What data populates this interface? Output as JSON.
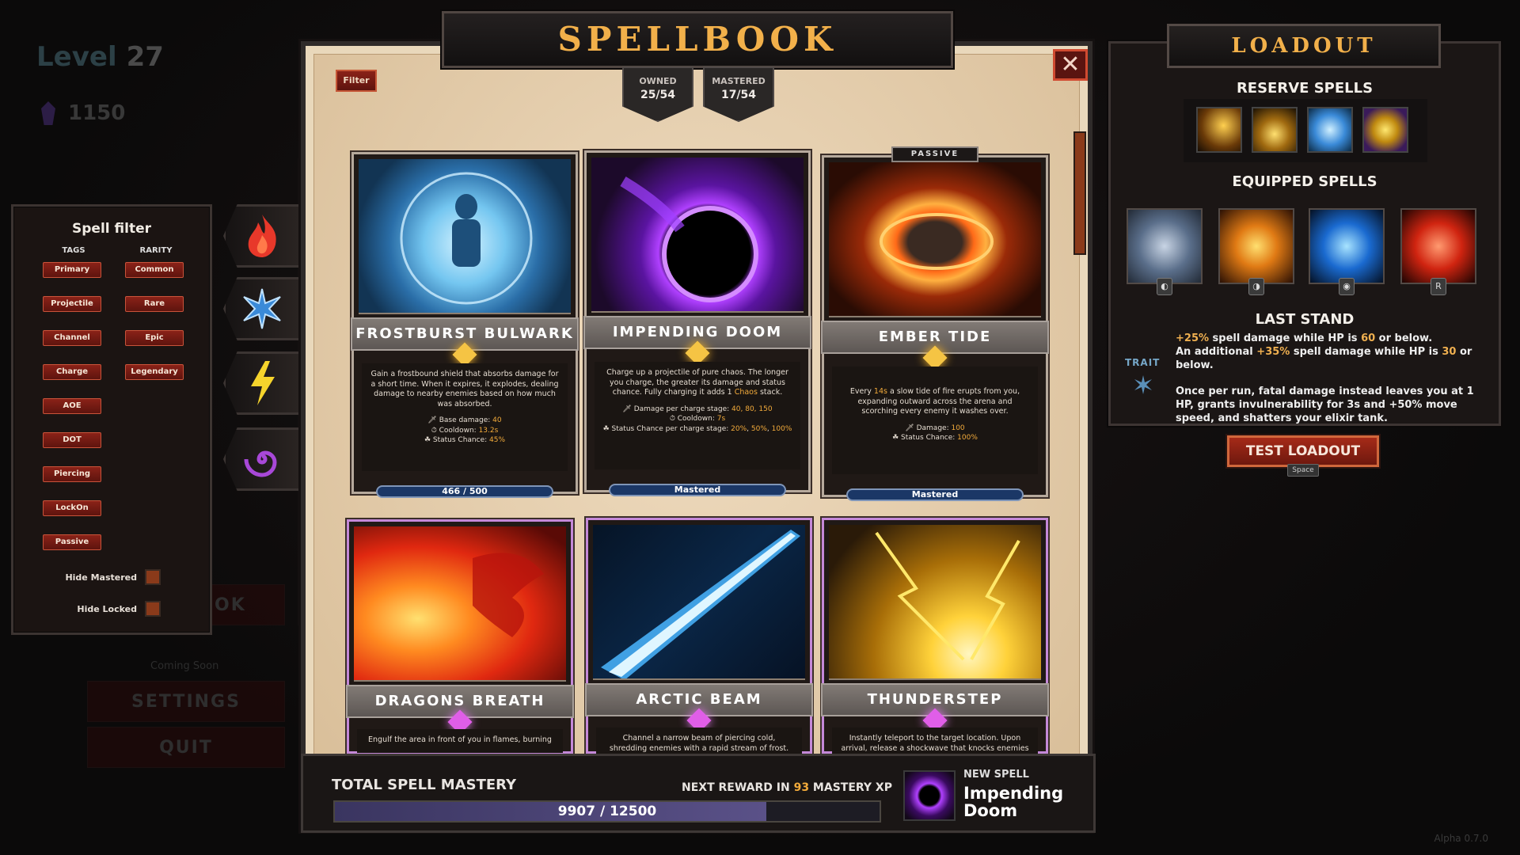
{
  "background": {
    "level_label": "Level",
    "level_value": "27",
    "gems": "1150",
    "menu_partial": "OK",
    "coming_soon": "Coming Soon",
    "settings": "SETTINGS",
    "quit": "QUIT",
    "version": "Alpha  0.7.0"
  },
  "filter": {
    "title": "Spell filter",
    "tags_header": "TAGS",
    "rarity_header": "RARITY",
    "tags": [
      "Primary",
      "Projectile",
      "Channel",
      "Charge",
      "AOE",
      "DOT",
      "Piercing",
      "LockOn",
      "Passive"
    ],
    "rarities": [
      "Common",
      "Rare",
      "Epic",
      "Legendary"
    ],
    "hide_mastered": "Hide Mastered",
    "hide_locked": "Hide Locked"
  },
  "element_tabs": [
    "fire-icon",
    "frost-icon",
    "lightning-icon",
    "chaos-icon"
  ],
  "spellbook": {
    "title": "SPELLBOOK",
    "filter_button": "Filter",
    "owned_label": "OWNED",
    "owned_value": "25/54",
    "mastered_label": "MASTERED",
    "mastered_value": "17/54",
    "close": "✕",
    "cards": [
      {
        "name": "FROSTBURST BULWARK",
        "desc": "Gain a frostbound shield that absorbs damage for a short time. When it expires, it explodes, dealing damage to nearby enemies based on how much was absorbed.",
        "stats": [
          "Base damage: 40",
          "Cooldown: 13.2s",
          "Status Chance: 45%"
        ],
        "progress_text": "466 / 500",
        "progress": 0.932,
        "passive": false
      },
      {
        "name": "IMPENDING DOOM",
        "desc": "Charge up a projectile of pure chaos. The longer you charge, the greater its damage and status chance. Fully charging it adds 1 Chaos stack.",
        "stats": [
          "Damage per charge stage: 40,  80,  150",
          "Cooldown: 7s",
          "Status Chance per charge stage: 20%, 50%, 100%"
        ],
        "progress_text": "Mastered",
        "progress": 1,
        "passive": false
      },
      {
        "name": "EMBER TIDE",
        "desc": "Every 14s a slow tide of fire erupts from you, expanding outward across the arena and scorching every enemy it washes over.",
        "stats": [
          "Damage: 100",
          "Status Chance: 100%"
        ],
        "progress_text": "Mastered",
        "progress": 1,
        "passive": true,
        "passive_label": "PASSIVE"
      },
      {
        "name": "DRAGONS BREATH",
        "desc": "Engulf the area in front of you in flames, burning",
        "passive": false
      },
      {
        "name": "ARCTIC BEAM",
        "desc": "Channel a narrow beam of piercing cold, shredding enemies with a rapid stream of frost.",
        "passive": false
      },
      {
        "name": "THUNDERSTEP",
        "desc": "Instantly teleport to the target location. Upon arrival, release a shockwave that knocks enemies back,",
        "passive": false
      }
    ]
  },
  "mastery": {
    "title": "TOTAL SPELL MASTERY",
    "next_reward_prefix": "NEXT REWARD IN ",
    "next_reward_value": "93",
    "next_reward_suffix": " MASTERY XP",
    "current": 9907,
    "max": 12500,
    "progress_text": "9907 / 12500",
    "new_spell_label": "NEW SPELL",
    "new_spell_name": "Impending Doom"
  },
  "loadout": {
    "title": "LOADOUT",
    "reserve_title": "RESERVE SPELLS",
    "equipped_title": "EQUIPPED SPELLS",
    "equipped_keys": [
      "mouse-left-icon",
      "mouse-right-icon",
      "mouse-middle-icon",
      "R"
    ],
    "trait_label": "TRAIT",
    "trait_name": "LAST STAND",
    "trait_line1_a": "+25%",
    "trait_line1_b": " spell damage while HP is ",
    "trait_line1_c": "60",
    "trait_line1_d": " or below.",
    "trait_line2_a": "An additional ",
    "trait_line2_b": "+35%",
    "trait_line2_c": " spell damage while HP is ",
    "trait_line2_d": "30",
    "trait_line2_e": " or below.",
    "trait_line3": "Once per run, fatal damage instead leaves you at 1 HP, grants invulnerability for 3s and +50% move speed, and shatters your elixir tank.",
    "test_button": "TEST LOADOUT",
    "test_key": "Space"
  },
  "colors": {
    "accent": "#f2b04a",
    "button": "#8a2218",
    "mastered_bar": "#1b3766"
  }
}
